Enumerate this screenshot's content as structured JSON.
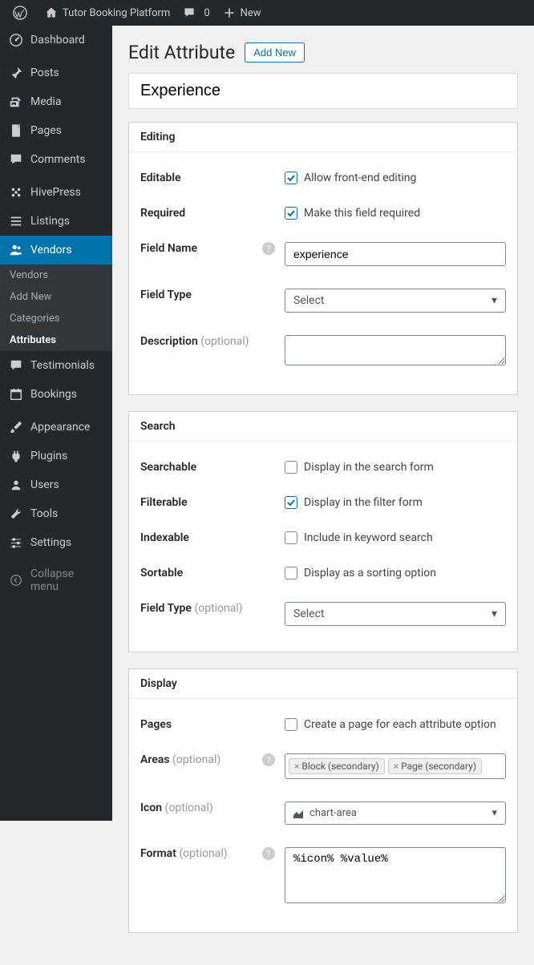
{
  "adminBar": {
    "siteName": "Tutor Booking Platform",
    "commentCount": "0",
    "newLabel": "New"
  },
  "sidebar": {
    "dashboard": "Dashboard",
    "posts": "Posts",
    "media": "Media",
    "pages": "Pages",
    "comments": "Comments",
    "hivepress": "HivePress",
    "listings": "Listings",
    "vendors": "Vendors",
    "vendors_sub_vendors": "Vendors",
    "vendors_sub_addnew": "Add New",
    "vendors_sub_categories": "Categories",
    "vendors_sub_attributes": "Attributes",
    "testimonials": "Testimonials",
    "bookings": "Bookings",
    "appearance": "Appearance",
    "plugins": "Plugins",
    "users": "Users",
    "tools": "Tools",
    "settings": "Settings",
    "collapse": "Collapse menu"
  },
  "page": {
    "title": "Edit Attribute",
    "addNewBtn": "Add New",
    "nameValue": "Experience"
  },
  "editing": {
    "sectionTitle": "Editing",
    "editableLabel": "Editable",
    "editableDesc": "Allow front-end editing",
    "requiredLabel": "Required",
    "requiredDesc": "Make this field required",
    "fieldNameLabel": "Field Name",
    "fieldNameValue": "experience",
    "fieldTypeLabel": "Field Type",
    "fieldTypeValue": "Select",
    "descriptionLabel": "Description",
    "descriptionOptional": " (optional)",
    "descriptionValue": ""
  },
  "search": {
    "sectionTitle": "Search",
    "searchableLabel": "Searchable",
    "searchableDesc": "Display in the search form",
    "filterableLabel": "Filterable",
    "filterableDesc": "Display in the filter form",
    "indexableLabel": "Indexable",
    "indexableDesc": "Include in keyword search",
    "sortableLabel": "Sortable",
    "sortableDesc": "Display as a sorting option",
    "fieldTypeLabel": "Field Type",
    "fieldTypeOptional": " (optional)",
    "fieldTypeValue": "Select"
  },
  "display": {
    "sectionTitle": "Display",
    "pagesLabel": "Pages",
    "pagesDesc": "Create a page for each attribute option",
    "areasLabel": "Areas",
    "areasOptional": " (optional)",
    "areaTag1": "Block (secondary)",
    "areaTag2": "Page (secondary)",
    "iconLabel": "Icon",
    "iconOptional": " (optional)",
    "iconValue": "chart-area",
    "formatLabel": "Format",
    "formatOptional": " (optional)",
    "formatValue": "%icon% %value%"
  }
}
